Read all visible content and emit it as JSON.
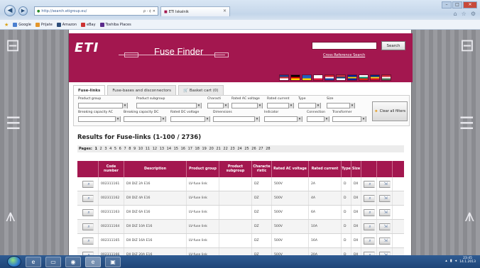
{
  "browser": {
    "address": "http://search.etigroup.eu/",
    "address_controls": "ρ - ¢ ✕",
    "tab_title": "ETI Iskalnik",
    "window_controls": [
      "–",
      "□",
      "✕"
    ],
    "favorites": [
      {
        "label": "Google",
        "color": "#4a7fd0"
      },
      {
        "label": "Prijate",
        "color": "#e3962b"
      },
      {
        "label": "Amazon",
        "color": "#2d4d7a"
      },
      {
        "label": "eBay",
        "color": "#c33"
      },
      {
        "label": "Toshiba Places",
        "color": "#5b2b8b"
      }
    ]
  },
  "header": {
    "logo": "ETI",
    "app_name": "Fuse Finder",
    "search_button": "Search",
    "cross_reference": "Cross Reference Search",
    "flags": [
      {
        "name": "uk",
        "colors": [
          "#1e3f8a",
          "#d32f2f",
          "#ffffff"
        ]
      },
      {
        "name": "germany",
        "colors": [
          "#000000",
          "#dd0000",
          "#ffce00"
        ]
      },
      {
        "name": "ukraine",
        "colors": [
          "#1f5fbf",
          "#1f5fbf",
          "#ffd500"
        ]
      },
      {
        "name": "poland",
        "colors": [
          "#ffffff",
          "#ffffff",
          "#dc143c"
        ]
      },
      {
        "name": "croatia",
        "colors": [
          "#d21f2b",
          "#ffffff",
          "#1d3f9a"
        ]
      },
      {
        "name": "serbia",
        "colors": [
          "#c6363c",
          "#0c4076",
          "#ffffff"
        ]
      },
      {
        "name": "bosnia",
        "colors": [
          "#002395",
          "#fecb00",
          "#002395"
        ]
      },
      {
        "name": "bulgaria",
        "colors": [
          "#ffffff",
          "#00966e",
          "#d62612"
        ]
      },
      {
        "name": "romania",
        "colors": [
          "#002b7f",
          "#fcd116",
          "#ce1126"
        ]
      },
      {
        "name": "hungary",
        "colors": [
          "#ce2939",
          "#ffffff",
          "#477050"
        ]
      }
    ]
  },
  "tabs": [
    {
      "label": "Fuse-links",
      "active": true
    },
    {
      "label": "Fuse-bases and disconnectors",
      "active": false
    },
    {
      "label": "Basket cart (0)",
      "active": false
    }
  ],
  "filters": {
    "row1": [
      "Product group",
      "Product subgroup",
      "Characti",
      "Rated AC voltage",
      "Rated current",
      "Type",
      "Size"
    ],
    "row2": [
      "Breaking capacity AC",
      "Breaking capacity DC",
      "Rated DC voltage",
      "Dimensions",
      "Indicator",
      "Connection",
      "Transformer"
    ],
    "clear_all": "Clear all filters"
  },
  "results": {
    "title": "Results for Fuse-links (1-100 / 2736)",
    "pages_label": "Pages:",
    "pages": [
      "1",
      "2",
      "3",
      "4",
      "5",
      "6",
      "7",
      "8",
      "9",
      "10",
      "11",
      "12",
      "13",
      "14",
      "15",
      "16",
      "17",
      "18",
      "19",
      "20",
      "21",
      "22",
      "23",
      "24",
      "25",
      "26",
      "27",
      "28"
    ]
  },
  "table": {
    "headers": [
      "",
      "Code number",
      "Description",
      "Product group",
      "Product subgroup",
      "Characte ristic",
      "Rated AC voltage",
      "Rated current",
      "Type",
      "Size",
      "",
      ""
    ],
    "rows": [
      {
        "code": "002311161",
        "description": "DII DIZ 2A E16",
        "group": "LV-fuse link",
        "characteristic": "DZ",
        "voltage": "500V",
        "current": "2A",
        "type": "D",
        "size": "DII"
      },
      {
        "code": "002311162",
        "description": "DII DIZ 4A E16",
        "group": "LV-fuse link",
        "characteristic": "DZ",
        "voltage": "500V",
        "current": "4A",
        "type": "D",
        "size": "DII"
      },
      {
        "code": "002311163",
        "description": "DII DIZ 6A E16",
        "group": "LV-fuse link",
        "characteristic": "DZ",
        "voltage": "500V",
        "current": "6A",
        "type": "D",
        "size": "DII"
      },
      {
        "code": "002311164",
        "description": "DII DIZ 10A E16",
        "group": "LV-fuse link",
        "characteristic": "DZ",
        "voltage": "500V",
        "current": "10A",
        "type": "D",
        "size": "DII"
      },
      {
        "code": "002311165",
        "description": "DII DIZ 16A E16",
        "group": "LV-fuse link",
        "characteristic": "DZ",
        "voltage": "500V",
        "current": "16A",
        "type": "D",
        "size": "DII"
      },
      {
        "code": "002311166",
        "description": "DII DIZ 20A E16",
        "group": "LV-fuse link",
        "characteristic": "DZ",
        "voltage": "500V",
        "current": "20A",
        "type": "D",
        "size": "DII"
      }
    ]
  },
  "taskbar": {
    "clock_time": "23:45",
    "clock_date": "14.1.2013"
  }
}
